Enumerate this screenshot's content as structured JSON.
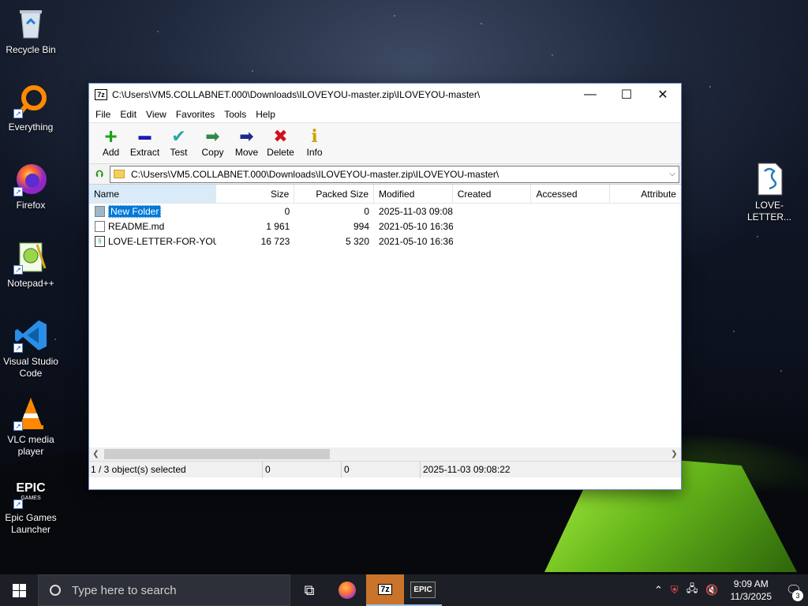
{
  "desktop": {
    "icons": [
      {
        "label": "Recycle Bin",
        "icon": "recycle-bin-icon"
      },
      {
        "label": "Everything",
        "icon": "everything-search-icon"
      },
      {
        "label": "Firefox",
        "icon": "firefox-icon"
      },
      {
        "label": "Notepad++",
        "icon": "notepad-plus-plus-icon"
      },
      {
        "label": "Visual Studio Code",
        "icon": "vscode-icon"
      },
      {
        "label": "VLC media player",
        "icon": "vlc-icon"
      },
      {
        "label": "Epic Games Launcher",
        "icon": "epic-games-icon"
      },
      {
        "label": "LOVE-LETTER...",
        "icon": "script-file-icon"
      }
    ]
  },
  "window": {
    "title": "C:\\Users\\VM5.COLLABNET.000\\Downloads\\ILOVEYOU-master.zip\\ILOVEYOU-master\\",
    "app_icon_text": "7z",
    "controls": {
      "minimize": "—",
      "maximize": "☐",
      "close": "✕"
    }
  },
  "menu": [
    "File",
    "Edit",
    "View",
    "Favorites",
    "Tools",
    "Help"
  ],
  "toolbar": [
    {
      "label": "Add",
      "icon": "plus-icon",
      "color": "#1aa31a",
      "glyph": "+"
    },
    {
      "label": "Extract",
      "icon": "minus-icon",
      "color": "#1b1bb5",
      "glyph": "▬"
    },
    {
      "label": "Test",
      "icon": "checkmark-icon",
      "color": "#2aa7a7",
      "glyph": "✔"
    },
    {
      "label": "Copy",
      "icon": "copy-arrow-icon",
      "color": "#2f8a4a",
      "glyph": "➡"
    },
    {
      "label": "Move",
      "icon": "move-arrow-icon",
      "color": "#1e2a8a",
      "glyph": "➡"
    },
    {
      "label": "Delete",
      "icon": "delete-x-icon",
      "color": "#d0121b",
      "glyph": "✖"
    },
    {
      "label": "Info",
      "icon": "info-icon",
      "color": "#c9a400",
      "glyph": "i"
    }
  ],
  "address": {
    "path": "C:\\Users\\VM5.COLLABNET.000\\Downloads\\ILOVEYOU-master.zip\\ILOVEYOU-master\\"
  },
  "columns": [
    "Name",
    "Size",
    "Packed Size",
    "Modified",
    "Created",
    "Accessed",
    "Attribute"
  ],
  "files": [
    {
      "name": "New Folder",
      "type": "folder",
      "size": "0",
      "packed": "0",
      "modified": "2025-11-03 09:08",
      "created": "",
      "accessed": "",
      "attr": "",
      "selected": true
    },
    {
      "name": "README.md",
      "type": "doc",
      "size": "1 961",
      "packed": "994",
      "modified": "2021-05-10 16:36",
      "created": "",
      "accessed": "",
      "attr": "",
      "selected": false
    },
    {
      "name": "LOVE-LETTER-FOR-YOU...",
      "type": "script",
      "size": "16 723",
      "packed": "5 320",
      "modified": "2021-05-10 16:36",
      "created": "",
      "accessed": "",
      "attr": "",
      "selected": false
    }
  ],
  "status": {
    "selection": "1 / 3 object(s) selected",
    "size": "0",
    "packed": "0",
    "modified": "2025-11-03 09:08:22"
  },
  "taskbar": {
    "search_placeholder": "Type here to search",
    "time": "9:09 AM",
    "date": "11/3/2025",
    "notifications": "3",
    "apps": [
      "task-view",
      "firefox",
      "7-zip",
      "epic-games"
    ]
  }
}
